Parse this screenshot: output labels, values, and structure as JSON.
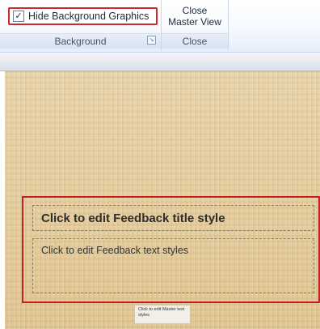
{
  "ribbon": {
    "background_group": {
      "checkbox": {
        "label": "Hide Background Graphics",
        "checked": true,
        "check_glyph": "✓"
      },
      "group_label": "Background",
      "launcher_icon": "dialog-launcher-icon",
      "launcher_glyph": "↘"
    },
    "close_group": {
      "button_line1": "Close",
      "button_line2": "Master View",
      "group_label": "Close"
    }
  },
  "slide": {
    "background_color": "#e6ce9f",
    "title_placeholder": "Click to edit Feedback title style",
    "body_placeholder": "Click to edit Feedback text styles",
    "footer_placeholder": "Click to edit Master text styles",
    "highlight_color": "#c81f25"
  }
}
